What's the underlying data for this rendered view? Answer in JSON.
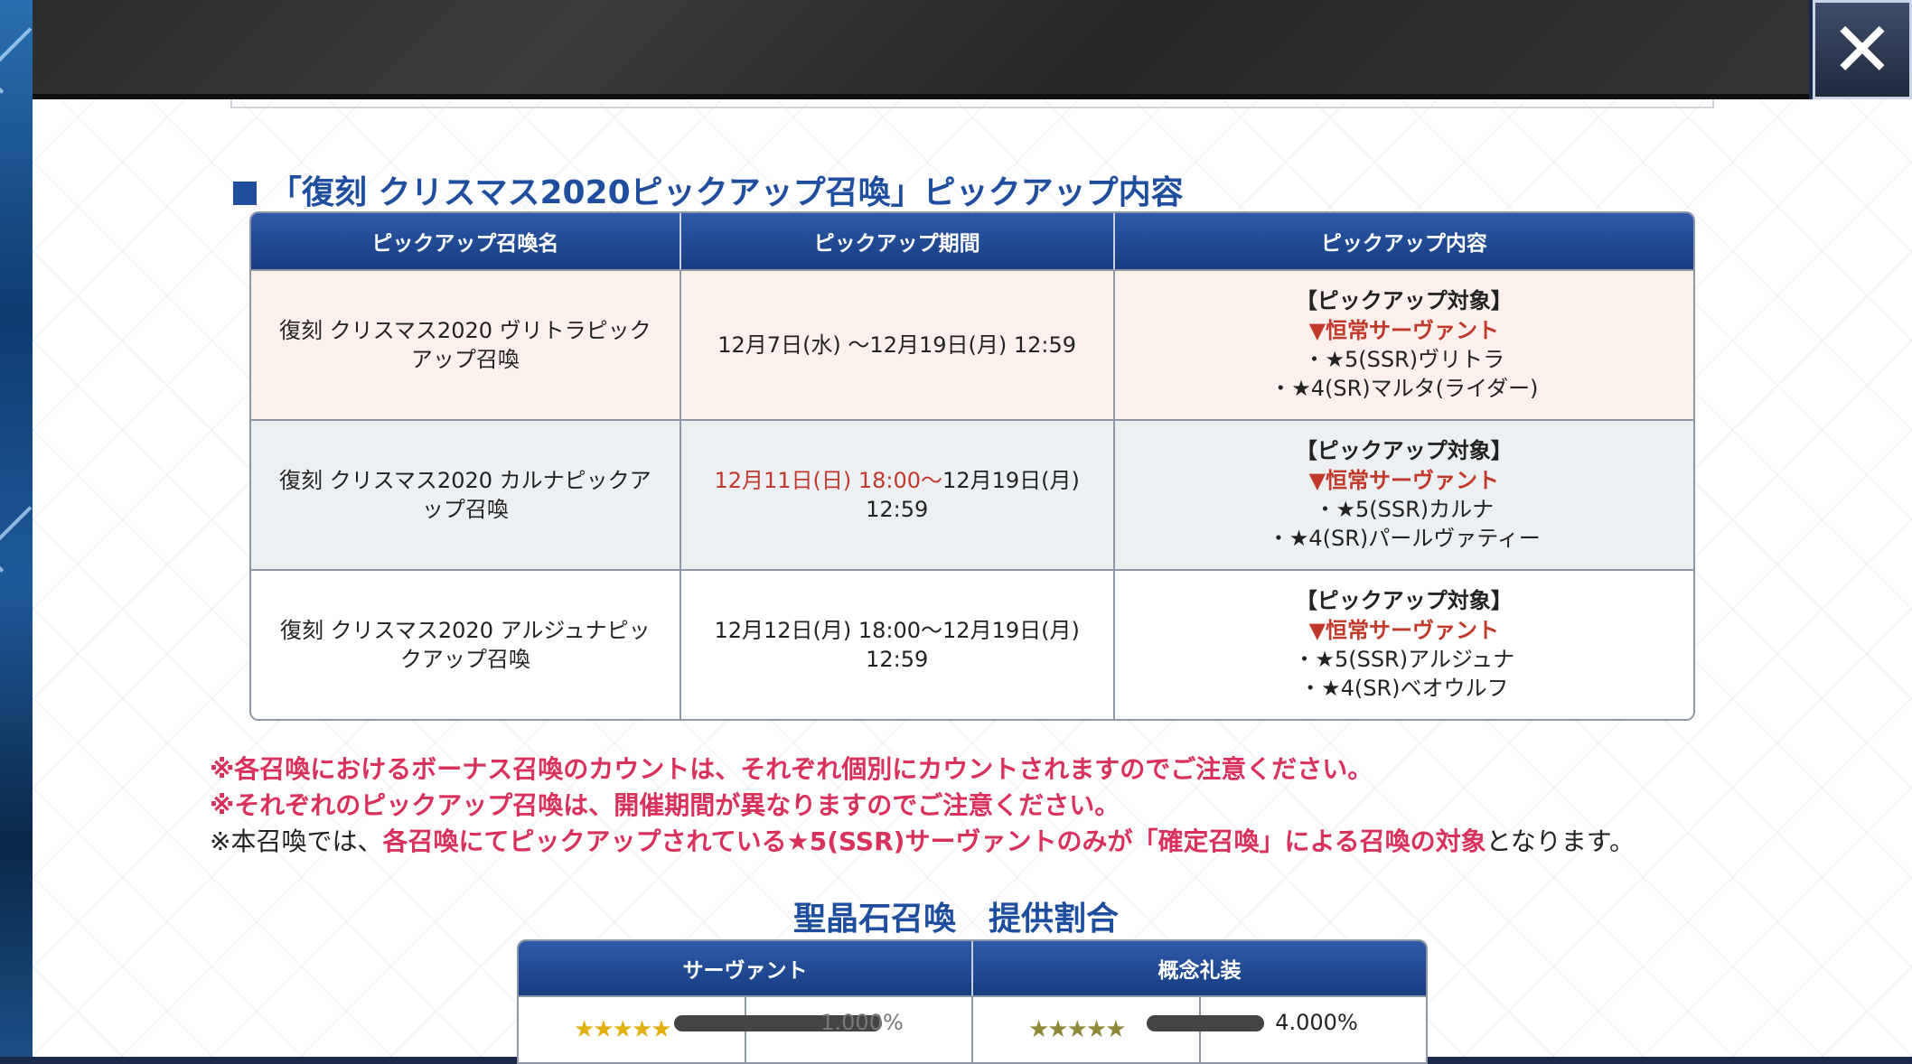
{
  "window": {
    "close_symbol": "✕"
  },
  "section": {
    "title": "「復刻 クリスマス2020ピックアップ召喚」ピックアップ内容"
  },
  "pickup_table": {
    "headers": [
      "ピックアップ召喚名",
      "ピックアップ期間",
      "ピックアップ内容"
    ],
    "rows": [
      {
        "name_line1": "復刻 クリスマス2020 ヴリトラピック",
        "name_line2": "アップ召喚",
        "period_red": "",
        "period_line1": "12月7日(水) 〜12月19日(月) 12:59",
        "period_line2": "",
        "target_label": "【ピックアップ対象】",
        "target_cat": "▼恒常サーヴァント",
        "item1": "・★5(SSR)ヴリトラ",
        "item2": "・★4(SR)マルタ(ライダー)"
      },
      {
        "name_line1": "復刻 クリスマス2020 カルナピックア",
        "name_line2": "ップ召喚",
        "period_red": "12月11日(日) 18:00〜",
        "period_line1": "12月19日(月)",
        "period_line2": "12:59",
        "target_label": "【ピックアップ対象】",
        "target_cat": "▼恒常サーヴァント",
        "item1": "・★5(SSR)カルナ",
        "item2": "・★4(SR)パールヴァティー"
      },
      {
        "name_line1": "復刻 クリスマス2020 アルジュナピッ",
        "name_line2": "クアップ召喚",
        "period_red": "",
        "period_line1": "12月12日(月) 18:00〜12月19日(月)",
        "period_line2": "12:59",
        "target_label": "【ピックアップ対象】",
        "target_cat": "▼恒常サーヴァント",
        "item1": "・★5(SSR)アルジュナ",
        "item2": "・★4(SR)ベオウルフ"
      }
    ]
  },
  "notes": {
    "line1": "※各召喚におけるボーナス召喚のカウントは、それぞれ個別にカウントされますのでご注意ください。",
    "line2": "※それぞれのピックアップ召喚は、開催期間が異なりますのでご注意ください。",
    "line3_a": "※本召喚では、",
    "line3_b": "各召喚にてピックアップされている★5(SSR)サーヴァントのみが「確定召喚」による召喚の対象",
    "line3_c": "となります。"
  },
  "rates": {
    "title": "聖晶石召喚　提供割合",
    "headers": [
      "サーヴァント",
      "概念礼装"
    ],
    "row1": {
      "servant_stars": "★★★★★",
      "servant_rate": "1.000%",
      "ce_stars": "★★★★★",
      "ce_rate": "4.000%"
    }
  },
  "colors": {
    "header_blue": "#1f4e9e",
    "note_pink": "#d8325c",
    "accent_red": "#c0392b"
  }
}
